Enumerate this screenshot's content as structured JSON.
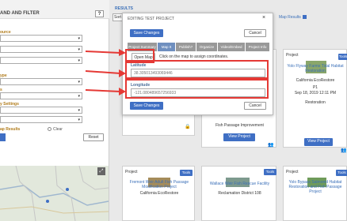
{
  "sidebar": {
    "title": "AND AND FILTER",
    "help_label": "?",
    "labels": [
      "ource",
      "ype",
      "s",
      "y Settings",
      "ap Results"
    ],
    "clear_label": "Clear",
    "reset_label": "Reset"
  },
  "results": {
    "title": "RESULTS",
    "sort_label": "Sort",
    "map_results_label": "Map Results"
  },
  "modal": {
    "title": "EDITING TEST PROJECT",
    "close_label": "×",
    "save_label": "Save Changes",
    "cancel_label": "Cancel",
    "tabs": [
      "Project Summary",
      "Map It",
      "Publish?",
      "Organize",
      "Video/Embed",
      "Project Info"
    ],
    "open_map_label": "Open Map",
    "map_hint": "Click on the map to assign coordinates.",
    "latitude_label": "Latitude",
    "latitude_value": "38.305013493069446",
    "longitude_label": "Longitude",
    "longitude_value": "-121.080489657256933"
  },
  "cards": {
    "c2": {
      "title": "Fish Passage Improvement",
      "view_label": "View Project"
    },
    "c3": {
      "head": "Project",
      "tools": "Tools",
      "title": "Yolo Flyway Farms Tidal Habitat Restoration",
      "org": "California EcoRestore",
      "code": "P1",
      "date": "Sep 18, 2019 12:11 PM",
      "type": "Restoration",
      "view_label": "View Project"
    },
    "c4": {
      "head": "Project",
      "tools": "Tools",
      "title": "Fremont Weir Adult Fish Passage Modification Project",
      "org": "California EcoRestore"
    },
    "c5": {
      "tools": "Tools",
      "title": "Wallace Weir Fish Rescue Facility",
      "org": "Reclamation District 108"
    },
    "c6": {
      "head": "Project",
      "tools": "Tools",
      "title": "Yolo Bypass Salmonid Habitat Restoration and Fish Passage Project"
    }
  },
  "colors": {
    "accent": "#3f6fc4",
    "highlight": "#e53935",
    "link": "#3a6fb8"
  }
}
